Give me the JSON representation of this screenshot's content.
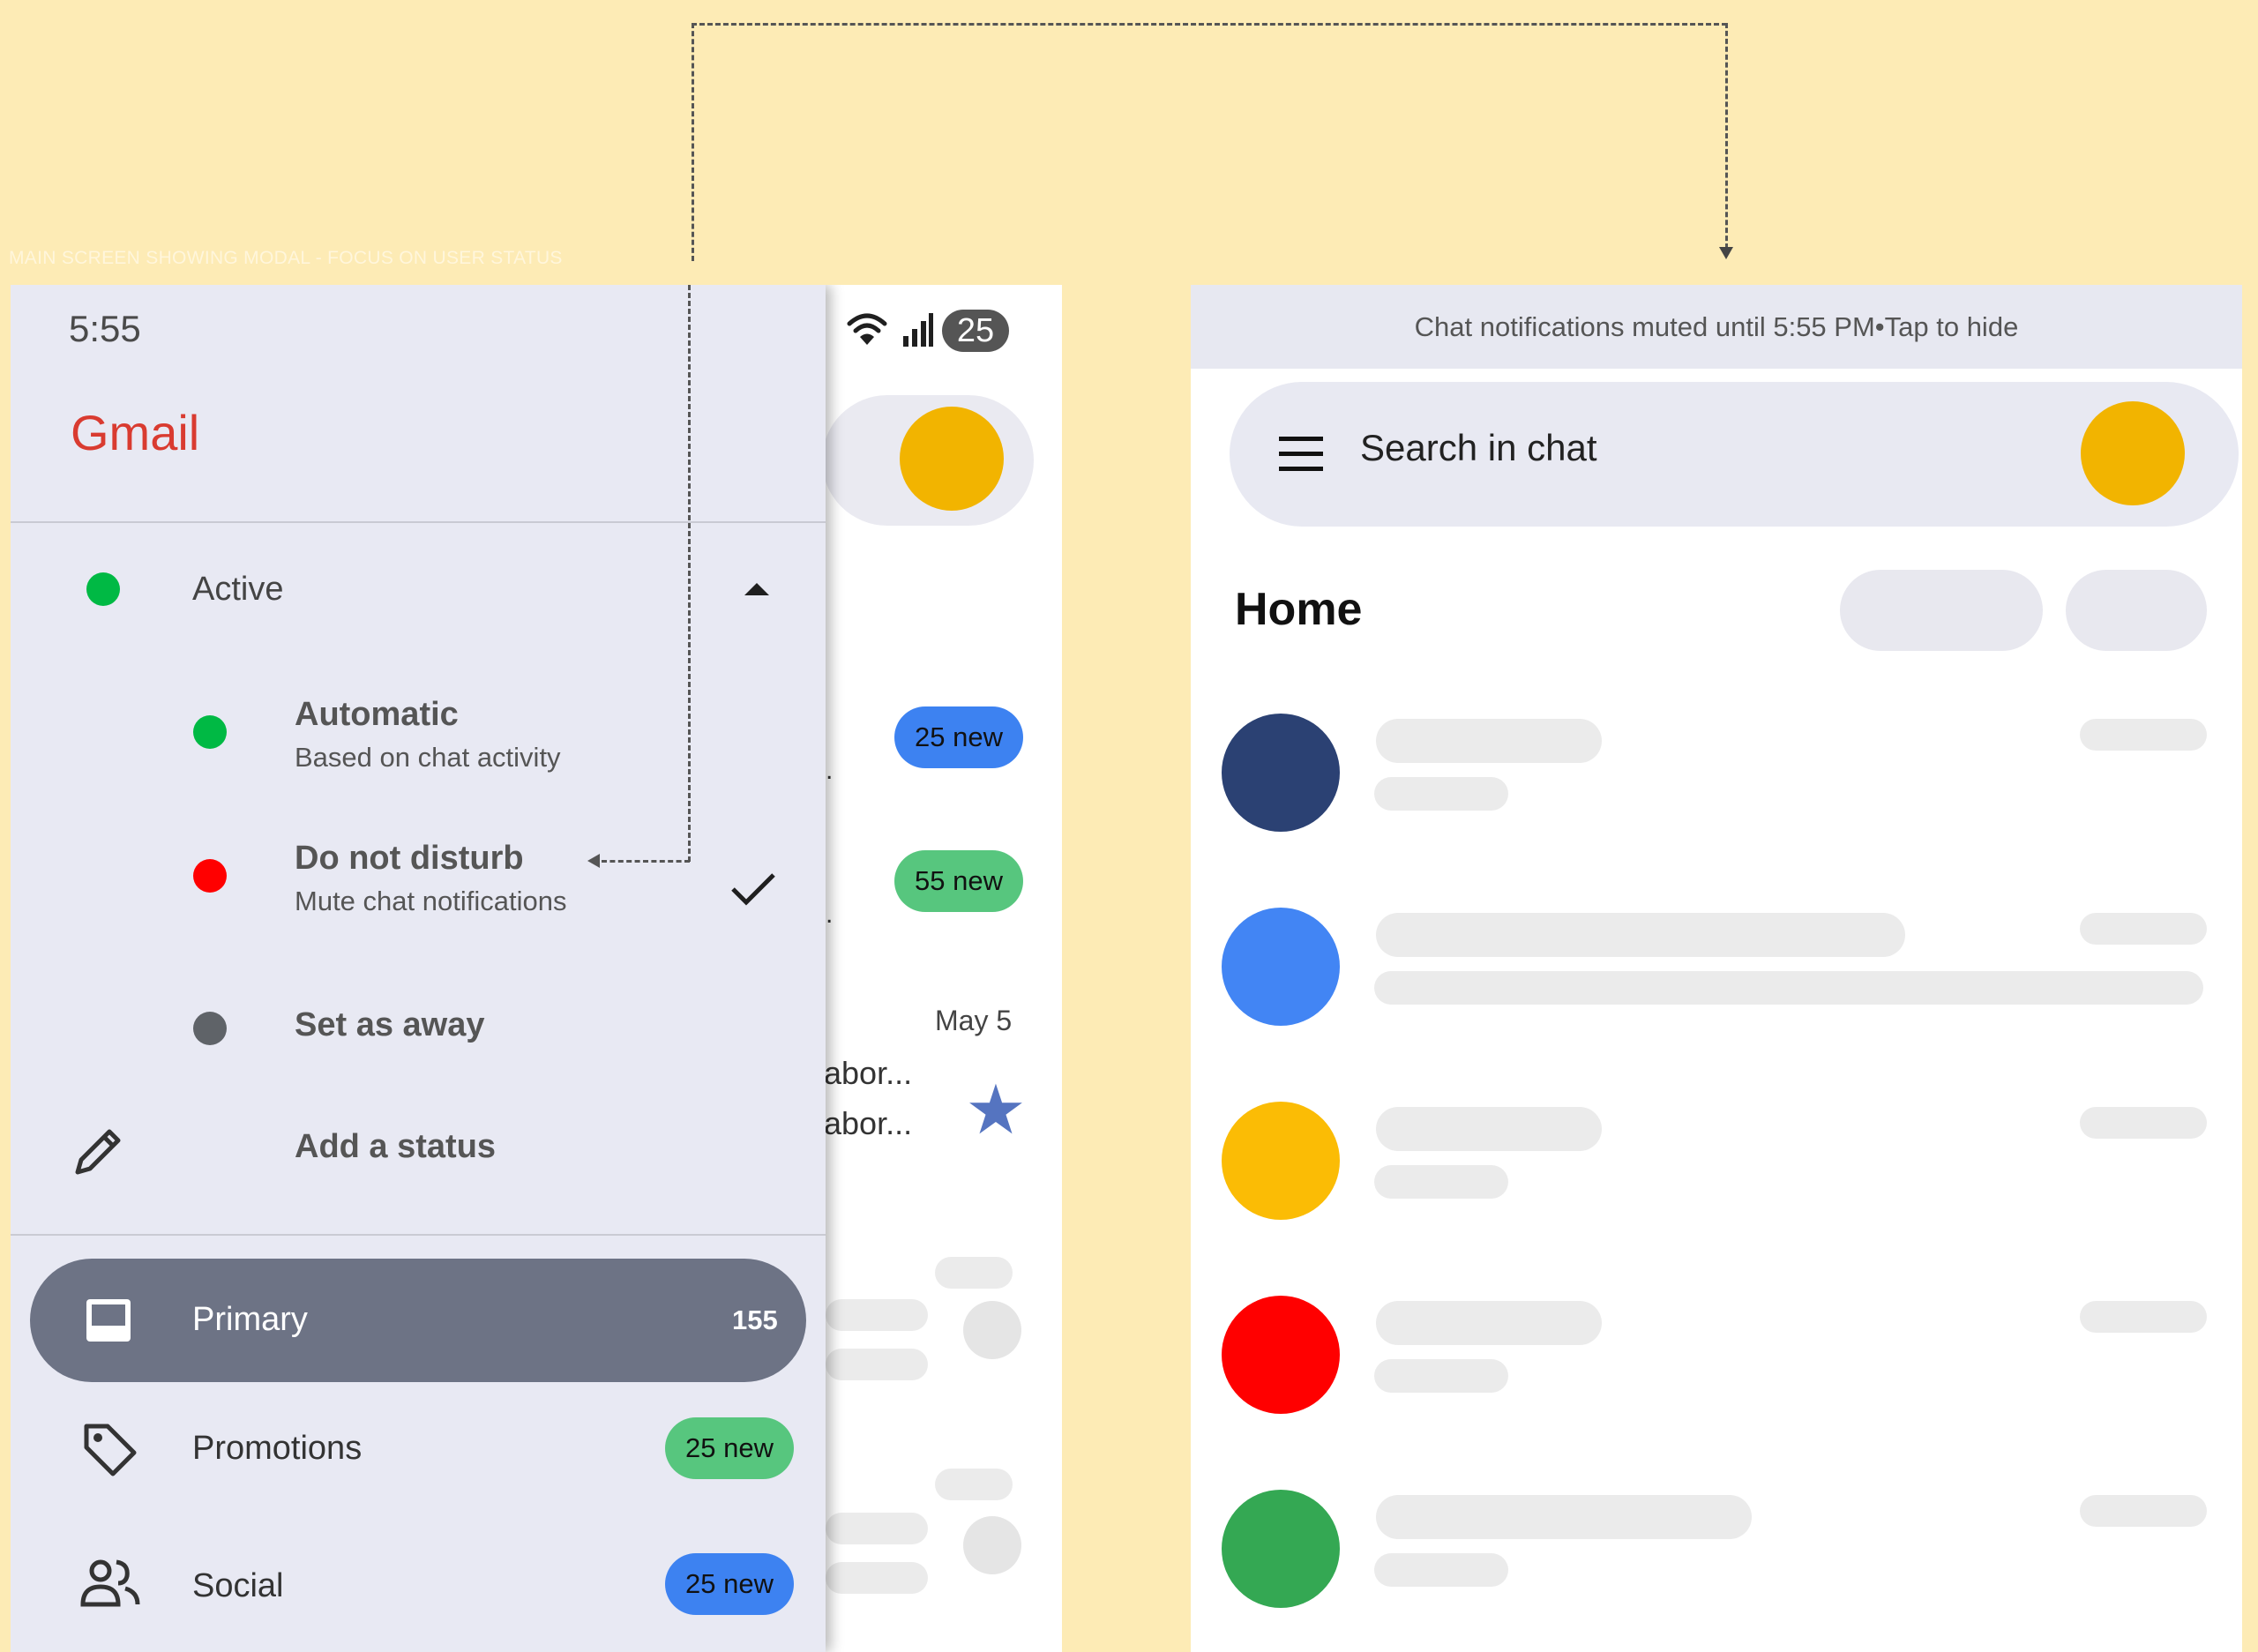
{
  "caption": "MAIN SCREEN SHOWING MODAL - FOCUS ON USER STATUS",
  "status_bar": {
    "time": "5:55",
    "battery": "25"
  },
  "drawer": {
    "app_name": "Gmail",
    "status": {
      "current_label": "Active",
      "options": [
        {
          "title": "Automatic",
          "subtitle": "Based on chat activity",
          "color": "#00b944"
        },
        {
          "title": "Do not disturb",
          "subtitle": "Mute chat notifications",
          "color": "#ff0000",
          "selected": true
        },
        {
          "title": "Set as away",
          "color": "#5f6368"
        }
      ],
      "add_status_label": "Add a status"
    },
    "nav": [
      {
        "label": "Primary",
        "count": "155",
        "active": true
      },
      {
        "label": "Promotions",
        "badge": "25 new",
        "badge_color": "#57c67e"
      },
      {
        "label": "Social",
        "badge": "25 new",
        "badge_color": "#3d82f1"
      }
    ]
  },
  "inbox_bg": {
    "badges": [
      "25 new",
      "55 new"
    ],
    "date": "May 5",
    "snippets": [
      "abor...",
      "abor..."
    ],
    "ellipsis": "."
  },
  "chat": {
    "notification": "Chat notifications muted until 5:55 PM•Tap to hide",
    "search_placeholder": "Search in chat",
    "home_title": "Home",
    "avatar_colors": [
      "#2b4173",
      "#4285f4",
      "#fbbc05",
      "#ff0000",
      "#34a853"
    ]
  },
  "colors": {
    "background": "#fdebb5",
    "accent_yellow": "#f2b400",
    "active_green": "#00b944",
    "dnd_red": "#ff0000"
  }
}
